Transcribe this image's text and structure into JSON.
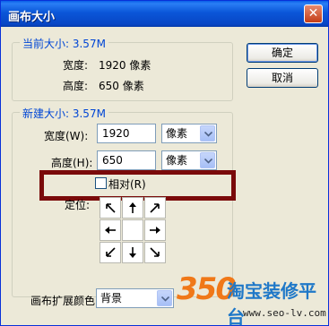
{
  "window": {
    "title": "画布大小",
    "close_glyph": "✕"
  },
  "current_size": {
    "legend": "当前大小: 3.57M",
    "width_label": "宽度:",
    "width_value": "1920 像素",
    "height_label": "高度:",
    "height_value": "650 像素"
  },
  "new_size": {
    "legend": "新建大小: 3.57M",
    "width_label": "宽度(W):",
    "width_value": "1920",
    "width_unit": "像素",
    "height_label": "高度(H):",
    "height_value": "650",
    "height_unit": "像素",
    "relative_label": "相对(R)",
    "relative_checked": false,
    "anchor_label": "定位:"
  },
  "anchor": {
    "selected": "center",
    "cells": [
      "arrow-up-left-icon",
      "arrow-up-icon",
      "arrow-up-right-icon",
      "arrow-left-icon",
      "",
      "arrow-right-icon",
      "arrow-down-left-icon",
      "arrow-down-icon",
      "arrow-down-right-icon"
    ]
  },
  "extension_color": {
    "label": "画布扩展颜色:",
    "value": "背景"
  },
  "buttons": {
    "ok": "确定",
    "cancel": "取消"
  },
  "watermark": {
    "number": "350",
    "name": "淘宝装修平台",
    "url": "www.seo-lv.com"
  },
  "colors": {
    "highlight": "#7a0a0a",
    "legend": "#0046d5",
    "title_bar": "#0a56d8"
  }
}
